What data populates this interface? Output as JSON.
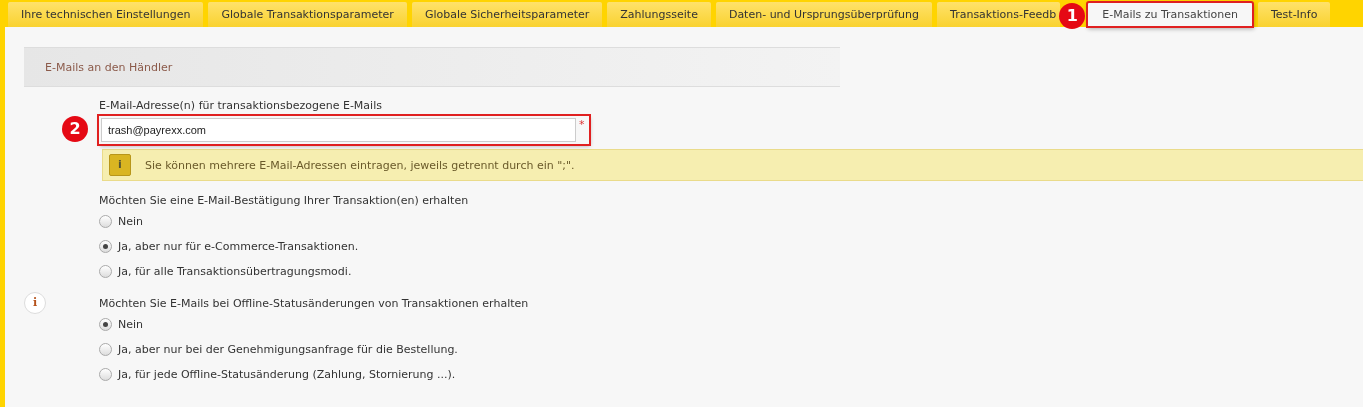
{
  "tabs": [
    {
      "label": "Ihre technischen Einstellungen",
      "selected": false
    },
    {
      "label": "Globale Transaktionsparameter",
      "selected": false
    },
    {
      "label": "Globale Sicherheitsparameter",
      "selected": false
    },
    {
      "label": "Zahlungsseite",
      "selected": false
    },
    {
      "label": "Daten- und Ursprungsüberprüfung",
      "selected": false
    },
    {
      "label": "Transaktions-Feedb",
      "selected": false
    },
    {
      "label": "E-Mails zu Transaktionen",
      "selected": true,
      "highlighted": true,
      "marker": "1"
    },
    {
      "label": "Test-Info",
      "selected": false
    }
  ],
  "section": {
    "title": "E-Mails an den Händler"
  },
  "email_field": {
    "label": "E-Mail-Adresse(n) für transaktionsbezogene E-Mails",
    "value": "trash@payrexx.com",
    "required": "*",
    "highlighted": true,
    "marker": "2"
  },
  "info_note": {
    "icon": "i",
    "text": "Sie können mehrere E-Mail-Adressen eintragen, jeweils getrennt durch ein \";\"."
  },
  "questions": [
    {
      "label": "Möchten Sie eine E-Mail-Bestätigung Ihrer Transaktion(en) erhalten",
      "options": [
        {
          "label": "Nein",
          "selected": false
        },
        {
          "label": "Ja, aber nur für e-Commerce-Transaktionen.",
          "selected": true
        },
        {
          "label": "Ja, für alle Transaktionsübertragungsmodi.",
          "selected": false
        }
      ]
    },
    {
      "label": "Möchten Sie E-Mails bei Offline-Statusänderungen von Transaktionen erhalten",
      "info_icon": "i",
      "options": [
        {
          "label": "Nein",
          "selected": true
        },
        {
          "label": "Ja, aber nur bei der Genehmigungsanfrage für die Bestellung.",
          "selected": false
        },
        {
          "label": "Ja, für jede Offline-Statusänderung (Zahlung, Stornierung ...).",
          "selected": false
        }
      ]
    }
  ]
}
